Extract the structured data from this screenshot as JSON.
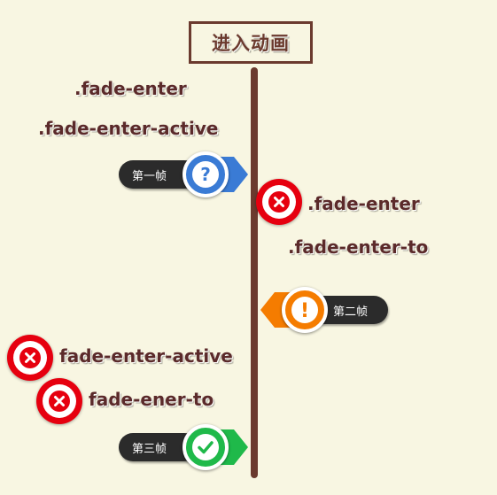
{
  "title": "进入动画",
  "left_labels": {
    "fade_enter": ".fade-enter",
    "fade_enter_active": ".fade-enter-active"
  },
  "right_labels": {
    "fade_enter": ".fade-enter",
    "fade_enter_to": ".fade-enter-to"
  },
  "lower_labels": {
    "fade_enter_active": "fade-enter-active",
    "fade_ener_to": "fade-ener-to"
  },
  "frames": [
    {
      "label": "第一帧",
      "icon": "question-icon",
      "color": "#3a7bd5"
    },
    {
      "label": "第二帧",
      "icon": "exclamation-icon",
      "color": "#f57c00"
    },
    {
      "label": "第三帧",
      "icon": "check-icon",
      "color": "#1fb94a"
    }
  ],
  "colors": {
    "background": "#f8f6e2",
    "timeline": "#6b3a2e",
    "text": "#5b2a2a",
    "error": "#e6000f"
  }
}
